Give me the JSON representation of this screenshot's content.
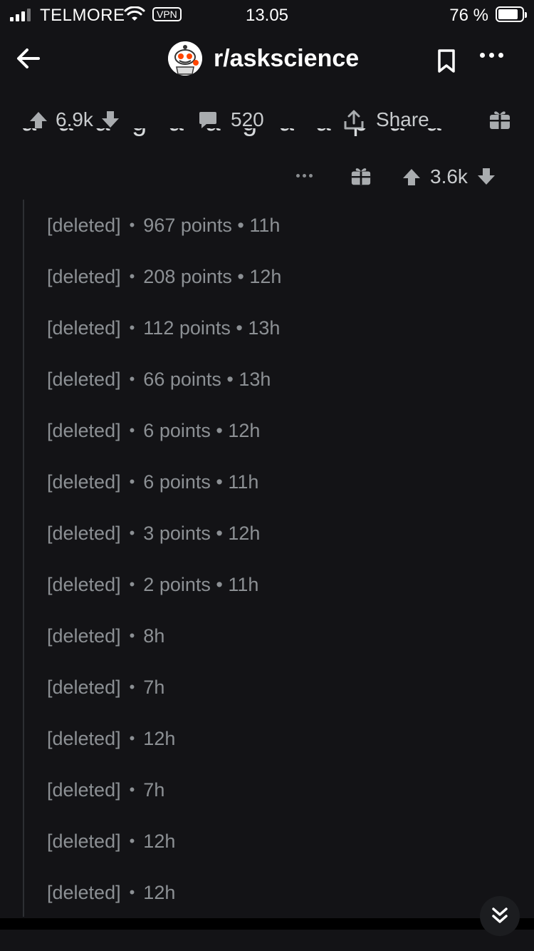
{
  "status_bar": {
    "carrier": "TELMORE",
    "vpn": "VPN",
    "time": "13.05",
    "battery": "76 %"
  },
  "header": {
    "subreddit": "r/askscience"
  },
  "post_actions": {
    "upvotes": "6.9k",
    "comments": "520",
    "share": "Share"
  },
  "comment_actions": {
    "votes": "3.6k"
  },
  "thread": [
    {
      "author": "[deleted]",
      "meta": "967 points • 11h"
    },
    {
      "author": "[deleted]",
      "meta": "208 points • 12h"
    },
    {
      "author": "[deleted]",
      "meta": "112 points • 13h"
    },
    {
      "author": "[deleted]",
      "meta": "66 points • 13h"
    },
    {
      "author": "[deleted]",
      "meta": "6 points • 12h"
    },
    {
      "author": "[deleted]",
      "meta": "6 points • 11h"
    },
    {
      "author": "[deleted]",
      "meta": "3 points • 12h"
    },
    {
      "author": "[deleted]",
      "meta": "2 points • 11h"
    },
    {
      "author": "[deleted]",
      "meta": "8h"
    },
    {
      "author": "[deleted]",
      "meta": "7h"
    },
    {
      "author": "[deleted]",
      "meta": "12h"
    },
    {
      "author": "[deleted]",
      "meta": "7h"
    },
    {
      "author": "[deleted]",
      "meta": "12h"
    },
    {
      "author": "[deleted]",
      "meta": "12h"
    }
  ],
  "colors": {
    "background": "#131316",
    "text": "#d7dadc",
    "muted": "#8c9094",
    "thread_line": "#2d2f33"
  },
  "icons": [
    "back-arrow-icon",
    "bookmark-icon",
    "more-icon",
    "upvote-icon",
    "downvote-icon",
    "comment-icon",
    "share-icon",
    "gift-icon",
    "jump-down-icon",
    "wifi-icon",
    "battery-icon"
  ]
}
